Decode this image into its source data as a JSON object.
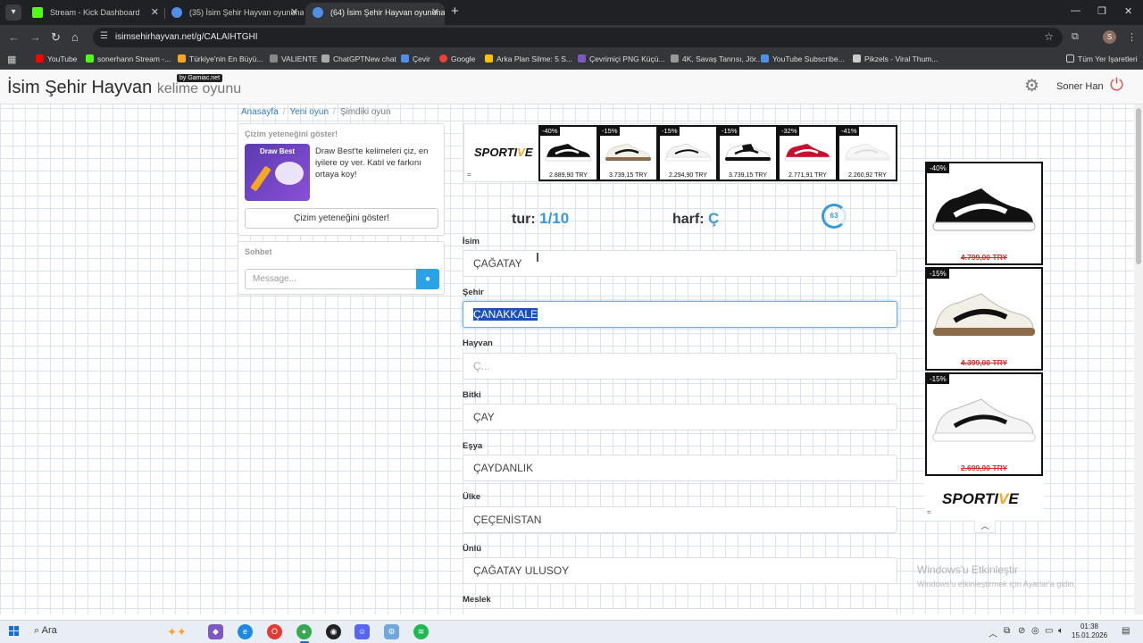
{
  "browser": {
    "tabs": [
      {
        "title": "Stream - Kick Dashboard",
        "color": "#53fc18"
      },
      {
        "title": "(35) İsim Şehir Hayvan oyununa",
        "color": "#4f8fe6"
      },
      {
        "title": "(64) İsim Şehir Hayvan oyununa",
        "color": "#4f8fe6"
      }
    ],
    "url": "isimsehirhayvan.net/g/CALAIHTGHI",
    "profile_initial": "S",
    "bookmarks": [
      {
        "label": "YouTube",
        "color": "#ff0000"
      },
      {
        "label": "sonerhann Stream -...",
        "color": "#53fc18"
      },
      {
        "label": "Türkiye'nin En Büyü...",
        "color": "#f5a623"
      },
      {
        "label": "VALIENTE",
        "color": "#888888"
      },
      {
        "label": "ChatGPTNew chat",
        "color": "#aaaaaa"
      },
      {
        "label": "Çevir",
        "color": "#4f8fe6"
      },
      {
        "label": "Google",
        "color": "#ea4335"
      },
      {
        "label": "Arka Plan Silme: 5 S...",
        "color": "#f5c400"
      },
      {
        "label": "Çevrimiçi PNG Küçü...",
        "color": "#7e57c2"
      },
      {
        "label": "4K, Savaş Tanrısı, Jör...",
        "color": "#999999"
      },
      {
        "label": "YouTube Subscribe...",
        "color": "#4f8fe6"
      },
      {
        "label": "Pikzels - Viral Thum...",
        "color": "#cccccc"
      }
    ],
    "all_bookmarks": "Tüm Yer İşaretleri"
  },
  "site": {
    "brand_main": "İsim Şehir Hayvan",
    "brand_sub": "kelime oyunu",
    "brand_badge": "by Gamiac.net",
    "user_name": "Soner Han"
  },
  "breadcrumb": {
    "home": "Anasayfa",
    "new_game": "Yeni oyun",
    "current": "Şimdiki oyun"
  },
  "draw_panel": {
    "title": "Çizim yeteneğini göster!",
    "image_title": "Draw Best",
    "text": "Draw Best'te kelimeleri çiz, en iyilere oy ver. Katıl ve farkını ortaya koy!",
    "button": "Çizim yeteneğini göster!"
  },
  "chat": {
    "title": "Sohbet",
    "placeholder": "Message..."
  },
  "ad_top": {
    "logo_a": "SPORTI",
    "logo_v": "V",
    "logo_b": "E",
    "eq": "=",
    "products": [
      {
        "discount": "-40%",
        "price": "2.889,90 TRY",
        "body": "#111111",
        "sole": "#ffffff"
      },
      {
        "discount": "-15%",
        "price": "3.739,15 TRY",
        "body": "#f2efe6",
        "sole": "#8b6b4a"
      },
      {
        "discount": "-15%",
        "price": "2.294,90 TRY",
        "body": "#f4f4f4",
        "sole": "#ffffff"
      },
      {
        "discount": "-15%",
        "price": "3.739,15 TRY",
        "body": "#ffffff",
        "sole": "#111111"
      },
      {
        "discount": "-32%",
        "price": "2.771,91 TRY",
        "body": "#c8102e",
        "sole": "#ffffff"
      },
      {
        "discount": "-41%",
        "price": "2.260,92 TRY",
        "body": "#f7f7f7",
        "sole": "#eeeeee"
      }
    ]
  },
  "game": {
    "round_label": "tur:",
    "round_value": "1/10",
    "letter_label": "harf:",
    "letter_value": "Ç",
    "timer": "63"
  },
  "fields": [
    {
      "label": "İsim",
      "value": "ÇAĞATAY",
      "placeholder": ""
    },
    {
      "label": "Şehir",
      "value": "ÇANAKKALE",
      "placeholder": ""
    },
    {
      "label": "Hayvan",
      "value": "",
      "placeholder": "Ç..."
    },
    {
      "label": "Bitki",
      "value": "ÇAY",
      "placeholder": ""
    },
    {
      "label": "Eşya",
      "value": "ÇAYDANLIK",
      "placeholder": ""
    },
    {
      "label": "Ülke",
      "value": "ÇEÇENİSTAN",
      "placeholder": ""
    },
    {
      "label": "Ünlü",
      "value": "ÇAĞATAY ULUSOY",
      "placeholder": ""
    },
    {
      "label": "Meslek",
      "value": "",
      "placeholder": ""
    }
  ],
  "ad_side": {
    "logo_a": "SPORTI",
    "logo_v": "V",
    "logo_b": "E",
    "eq": "=",
    "products": [
      {
        "discount": "-40%",
        "old_price": "4.799,00 TRY"
      },
      {
        "discount": "-15%",
        "old_price": "4.399,00 TRY"
      },
      {
        "discount": "-15%",
        "old_price": "2.699,90 TRY"
      }
    ]
  },
  "windows": {
    "activate_title": "Windows'u Etkinleştir",
    "activate_text": "Windows'u etkinleştirmek için Ayarlar'a gidin.",
    "search": "Ara",
    "time": "01:38",
    "date": "15.01.2026"
  }
}
